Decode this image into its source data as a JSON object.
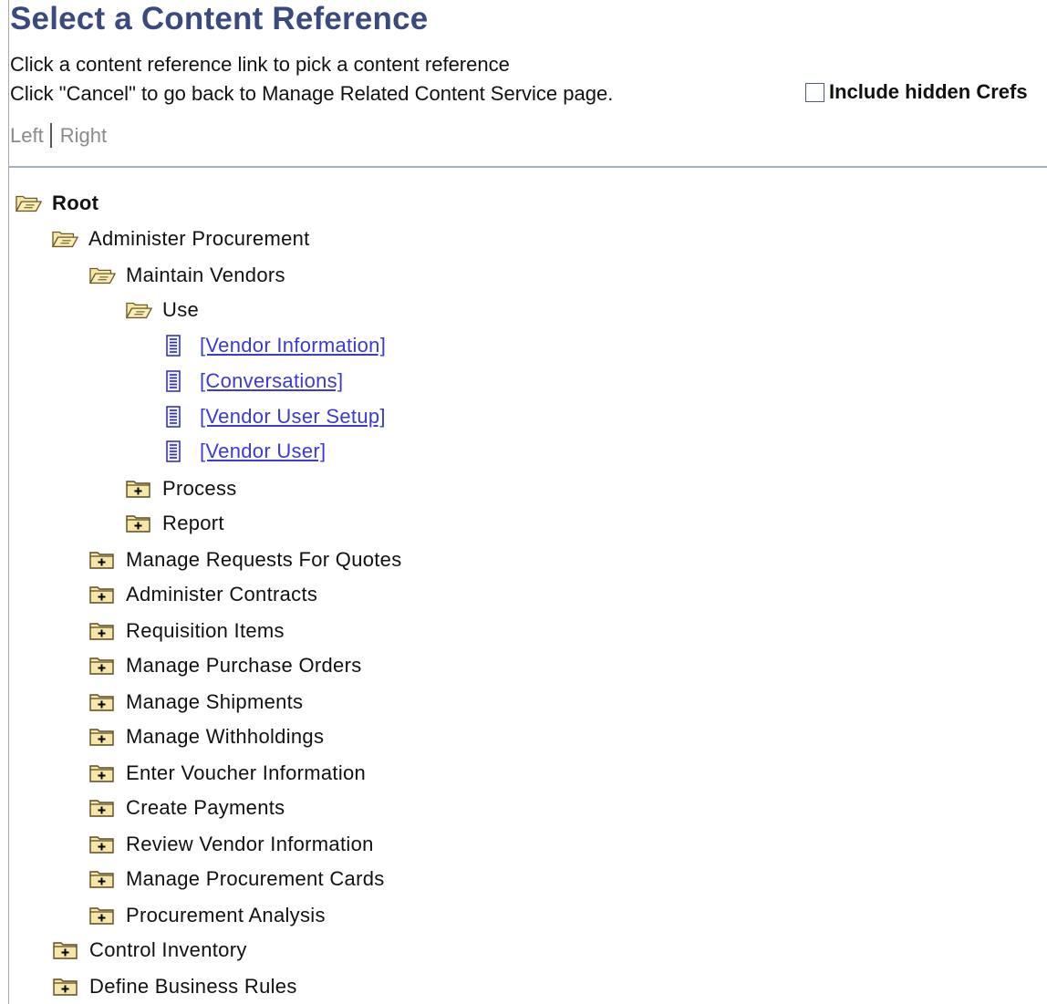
{
  "header": {
    "title": "Select a Content Reference",
    "instruction_1": "Click a content reference link to pick a content reference",
    "instruction_2": "Click \"Cancel\" to go back to Manage Related Content Service page.",
    "include_hidden_label": "Include hidden Crefs",
    "include_hidden_checked": false,
    "left_label": "Left",
    "right_label": "Right"
  },
  "tree": {
    "root": "Root",
    "administer_procurement": "Administer Procurement",
    "maintain_vendors": "Maintain Vendors",
    "use": "Use",
    "vendor_information": "[Vendor Information]",
    "conversations": "[Conversations]",
    "vendor_user_setup": "[Vendor User Setup]",
    "vendor_user": "[Vendor User]",
    "process": "Process",
    "report": "Report",
    "manage_rfq": "Manage Requests For Quotes",
    "administer_contracts": "Administer Contracts",
    "requisition_items": "Requisition Items",
    "manage_purchase_orders": "Manage Purchase Orders",
    "manage_shipments": "Manage Shipments",
    "manage_withholdings": "Manage Withholdings",
    "enter_voucher_information": "Enter Voucher Information",
    "create_payments": "Create Payments",
    "review_vendor_information": "Review Vendor Information",
    "manage_procurement_cards": "Manage Procurement Cards",
    "procurement_analysis": "Procurement Analysis",
    "control_inventory": "Control Inventory",
    "define_business_rules": "Define Business Rules"
  },
  "icons": {
    "open_folder": "folder-open-icon",
    "collapsed_folder": "folder-plus-icon",
    "document": "document-icon"
  },
  "colors": {
    "title": "#3b4a7e",
    "link": "#3a3ad6",
    "disabled_link": "#8a8a8a",
    "divider": "#a6aec4"
  }
}
